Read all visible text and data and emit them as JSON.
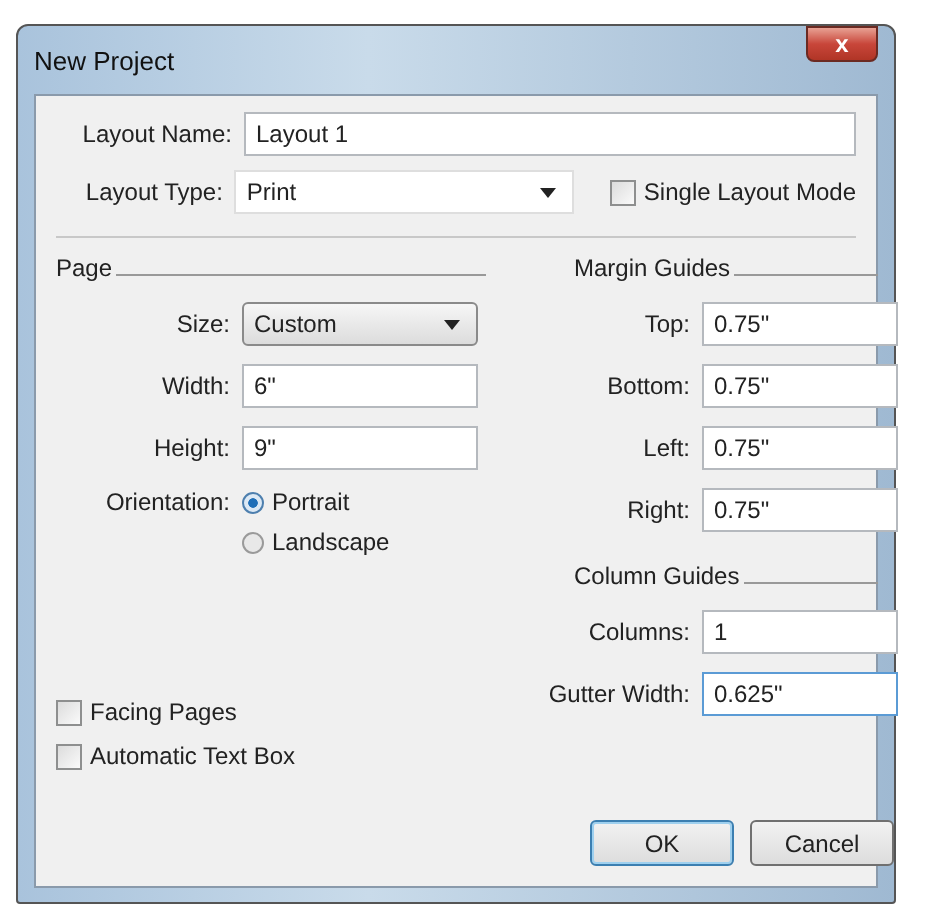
{
  "window": {
    "title": "New Project",
    "close": "x"
  },
  "layout_name": {
    "label": "Layout Name:",
    "value": "Layout 1"
  },
  "layout_type": {
    "label": "Layout Type:",
    "value": "Print"
  },
  "single_layout_mode": {
    "label": "Single Layout Mode",
    "checked": false
  },
  "page": {
    "title": "Page",
    "size": {
      "label": "Size:",
      "value": "Custom"
    },
    "fields": [
      {
        "label": "Width:",
        "value": "6\""
      },
      {
        "label": "Height:",
        "value": "9\""
      }
    ],
    "orientation": {
      "label": "Orientation:",
      "options": [
        {
          "label": "Portrait",
          "selected": true
        },
        {
          "label": "Landscape",
          "selected": false
        }
      ]
    },
    "options": [
      {
        "label": "Facing Pages",
        "checked": false
      },
      {
        "label": "Automatic Text Box",
        "checked": false
      }
    ]
  },
  "margin_guides": {
    "title": "Margin Guides",
    "fields": [
      {
        "label": "Top:",
        "value": "0.75\""
      },
      {
        "label": "Bottom:",
        "value": "0.75\""
      },
      {
        "label": "Left:",
        "value": "0.75\""
      },
      {
        "label": "Right:",
        "value": "0.75\""
      }
    ]
  },
  "column_guides": {
    "title": "Column Guides",
    "fields": [
      {
        "label": "Columns:",
        "value": "1",
        "focused": false
      },
      {
        "label": "Gutter Width:",
        "value": "0.625\"",
        "focused": true
      }
    ]
  },
  "buttons": [
    {
      "label": "OK",
      "default": true
    },
    {
      "label": "Cancel",
      "default": false
    }
  ]
}
